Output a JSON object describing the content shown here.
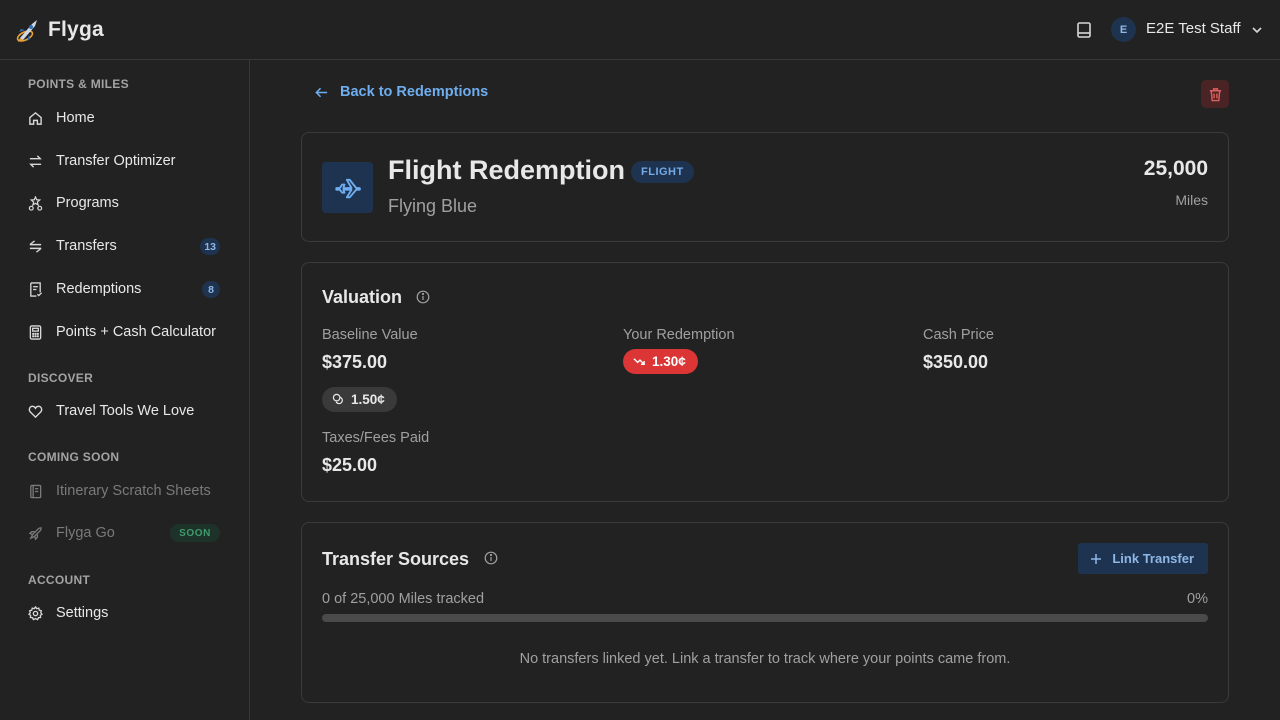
{
  "app": {
    "name": "Flyga"
  },
  "user": {
    "initial": "E",
    "name": "E2E Test Staff"
  },
  "sidebar": {
    "sections": [
      {
        "label": "POINTS & MILES"
      },
      {
        "label": "DISCOVER"
      },
      {
        "label": "COMING SOON"
      },
      {
        "label": "ACCOUNT"
      }
    ],
    "items": [
      {
        "label": "Home",
        "icon": "home-icon"
      },
      {
        "label": "Transfer Optimizer",
        "icon": "swap-icon"
      },
      {
        "label": "Programs",
        "icon": "stars-icon"
      },
      {
        "label": "Transfers",
        "icon": "transfer-arrows-icon",
        "badge": "13"
      },
      {
        "label": "Redemptions",
        "icon": "receipt-icon",
        "badge": "8"
      },
      {
        "label": "Points + Cash Calculator",
        "icon": "calculator-icon"
      },
      {
        "label": "Travel Tools We Love",
        "icon": "heart-icon"
      },
      {
        "label": "Itinerary Scratch Sheets",
        "icon": "notebook-icon",
        "disabled": true
      },
      {
        "label": "Flyga Go",
        "icon": "rocket-icon",
        "disabled": true,
        "badge": "SOON"
      },
      {
        "label": "Settings",
        "icon": "gear-icon"
      }
    ]
  },
  "main": {
    "back_label": "Back to Redemptions",
    "redemption": {
      "title": "Flight Redemption",
      "type_badge": "FLIGHT",
      "program": "Flying Blue",
      "amount": "25,000",
      "unit": "Miles"
    },
    "valuation": {
      "heading": "Valuation",
      "baseline_label": "Baseline Value",
      "baseline_value": "$375.00",
      "baseline_cpp": "1.50¢",
      "your_label": "Your Redemption",
      "your_cpp": "1.30¢",
      "cash_label": "Cash Price",
      "cash_value": "$350.00",
      "taxes_label": "Taxes/Fees Paid",
      "taxes_value": "$25.00"
    },
    "transfer_sources": {
      "heading": "Transfer Sources",
      "link_button": "Link Transfer",
      "progress_text": "0 of 25,000 Miles tracked",
      "progress_pct": "0%",
      "progress_fraction": 0,
      "empty_message": "No transfers linked yet. Link a transfer to track where your points came from."
    }
  },
  "colors": {
    "background": "#222222",
    "accent": "#6eaef0",
    "danger": "#dc3535",
    "success": "#3f9c6c"
  }
}
